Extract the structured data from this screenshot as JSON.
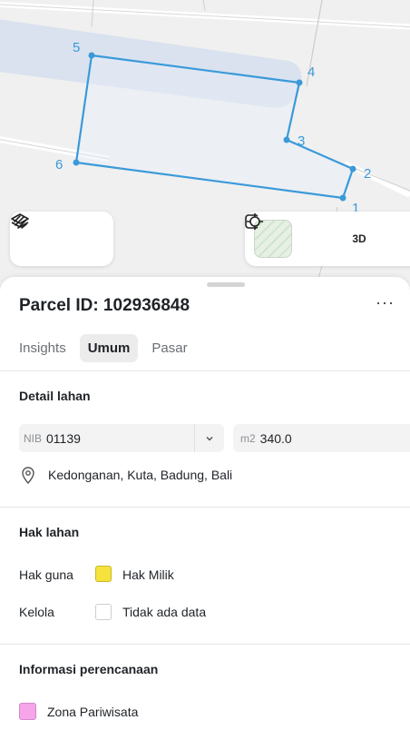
{
  "map": {
    "vertex_labels": [
      "1",
      "2",
      "3",
      "4",
      "5",
      "6"
    ],
    "toolbar_left": {
      "layers_icon": "layers-icon",
      "draw_icon": "draw-line-icon"
    },
    "toolbar_right": {
      "basemap_icon": "satellite-thumbnail",
      "locate_icon": "crosshair-icon",
      "view_3d_label": "3D"
    },
    "colors": {
      "parcel_outline": "#3a9ad9",
      "parcel_fill": "#e6eef8",
      "road_band": "#d6dfee"
    }
  },
  "parcel": {
    "title": "Parcel ID: 102936848",
    "more_label": "···",
    "tabs": [
      {
        "label": "Insights",
        "active": false
      },
      {
        "label": "Umum",
        "active": true
      },
      {
        "label": "Pasar",
        "active": false
      }
    ]
  },
  "detail_lahan": {
    "title": "Detail lahan",
    "nib_prefix": "NIB",
    "nib_value": "01139",
    "area_prefix": "m2",
    "area_value": "340.0",
    "location": "Kedonganan, Kuta, Badung, Bali"
  },
  "hak_lahan": {
    "title": "Hak lahan",
    "rows": [
      {
        "label": "Hak guna",
        "value": "Hak Milik",
        "color": "#f5e23c"
      },
      {
        "label": "Kelola",
        "value": "Tidak ada data",
        "color": "#ffffff"
      }
    ]
  },
  "perencanaan": {
    "title": "Informasi perencanaan",
    "zone_label": "Zona Pariwisata",
    "zone_color": "#f6a6e8"
  }
}
